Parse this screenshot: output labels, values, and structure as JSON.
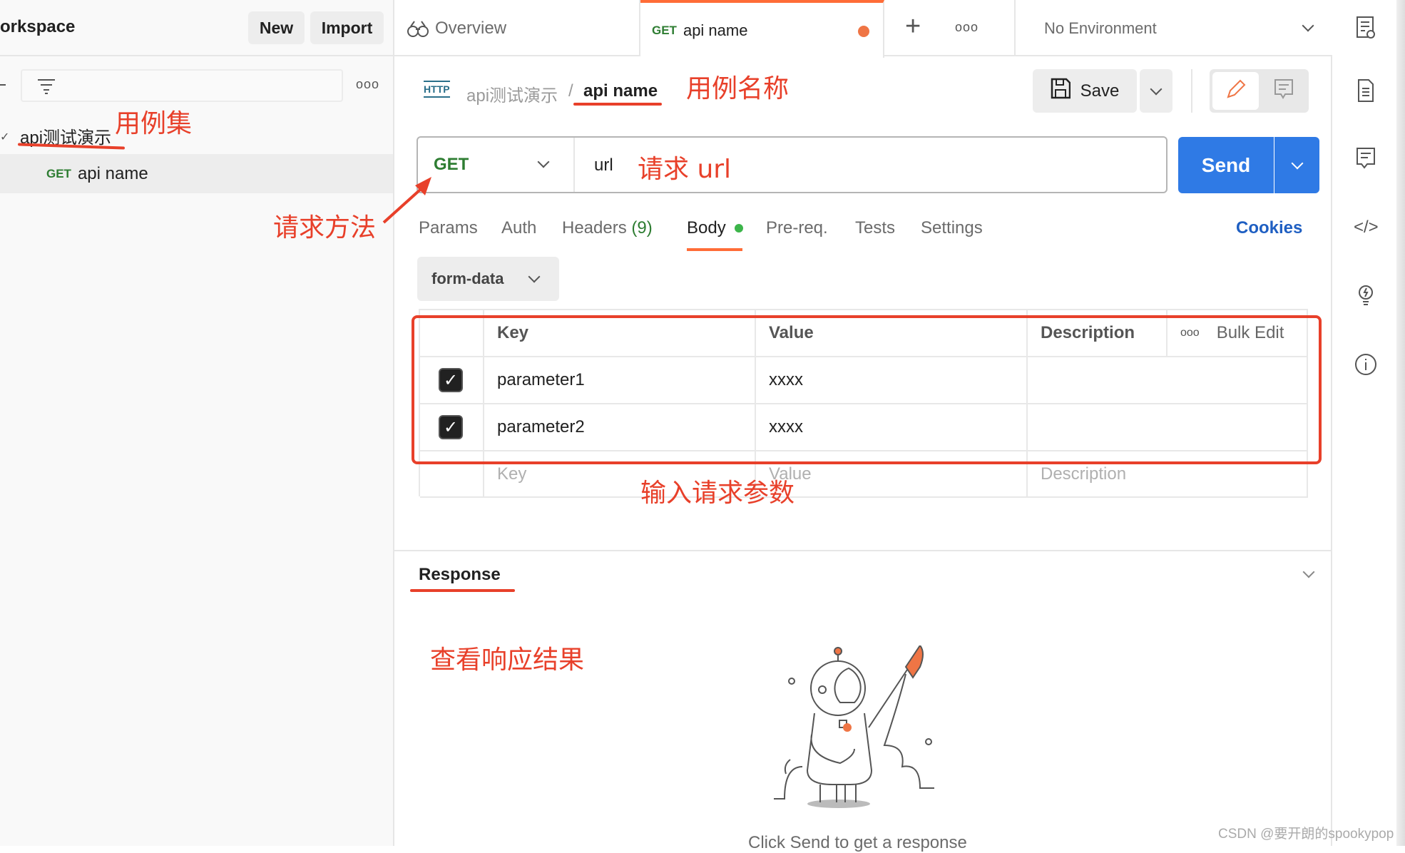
{
  "sidebar": {
    "workspace_title": "orkspace",
    "new_label": "New",
    "import_label": "Import",
    "collection": "api测试演示",
    "request_method": "GET",
    "request_name": "api name"
  },
  "tabs": {
    "overview": "Overview",
    "active_method": "GET",
    "active_name": "api name",
    "environment": "No Environment"
  },
  "breadcrumb": {
    "collection": "api测试演示",
    "separator": "/",
    "request": "api name"
  },
  "toolbar": {
    "save_label": "Save"
  },
  "request": {
    "method": "GET",
    "url": "url",
    "send_label": "Send"
  },
  "request_tabs": [
    {
      "label": "Params"
    },
    {
      "label": "Auth"
    },
    {
      "label": "Headers",
      "count": "(9)"
    },
    {
      "label": "Body"
    },
    {
      "label": "Pre-req."
    },
    {
      "label": "Tests"
    },
    {
      "label": "Settings"
    }
  ],
  "cookies_label": "Cookies",
  "body_type": "form-data",
  "table": {
    "headers": [
      "Key",
      "Value",
      "Description"
    ],
    "bulk_edit": "Bulk Edit",
    "rows": [
      {
        "key": "parameter1",
        "value": "xxxx",
        "checked": true
      },
      {
        "key": "parameter2",
        "value": "xxxx",
        "checked": true
      }
    ],
    "placeholders": {
      "key": "Key",
      "value": "Value",
      "description": "Description"
    }
  },
  "response": {
    "title": "Response",
    "empty_text": "Click Send to get a response"
  },
  "annotations": {
    "collection": "用例集",
    "method": "请求方法",
    "name": "用例名称",
    "url": "请求 url",
    "params": "输入请求参数",
    "response": "查看响应结果"
  },
  "watermark": "CSDN @要开朗的spookypop",
  "colors": {
    "accent": "#ff6c37",
    "send": "#2f7ae5",
    "get": "#2e7d32",
    "annotation": "#e8402a",
    "cookies": "#1f5fc2"
  }
}
